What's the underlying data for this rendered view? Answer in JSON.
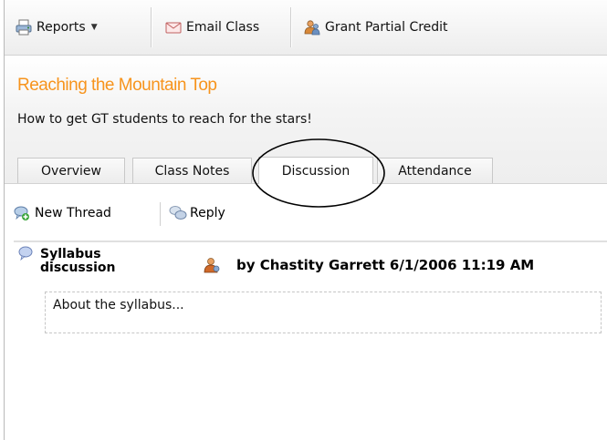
{
  "toolbar": {
    "reports_label": "Reports",
    "email_label": "Email Class",
    "credit_label": "Grant Partial Credit"
  },
  "header": {
    "title": "Reaching the Mountain Top",
    "description": "How to get GT students to reach for the stars!"
  },
  "tabs": [
    {
      "label": "Overview"
    },
    {
      "label": "Class Notes"
    },
    {
      "label": "Discussion",
      "active": true
    },
    {
      "label": "Attendance"
    }
  ],
  "discussion_toolbar": {
    "new_thread_label": "New Thread",
    "reply_label": "Reply"
  },
  "thread": {
    "title": "Syllabus discussion",
    "byline": "by Chastity Garrett 6/1/2006 11:19 AM",
    "message": "About the syllabus..."
  },
  "colors": {
    "title_accent": "#f7941d"
  }
}
